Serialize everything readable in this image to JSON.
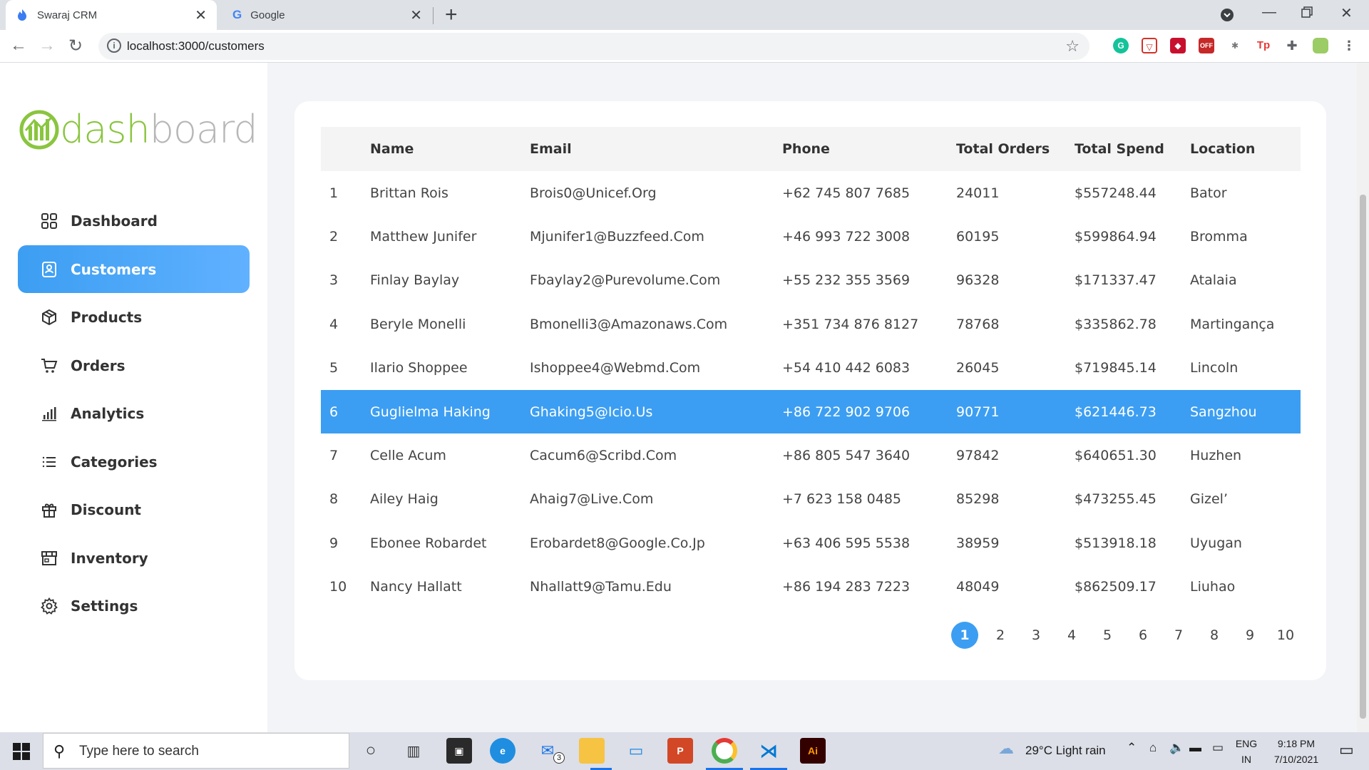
{
  "browser": {
    "tabs": [
      {
        "title": "Swaraj CRM",
        "active": true
      },
      {
        "title": "Google",
        "active": false
      }
    ],
    "url": "localhost:3000/customers"
  },
  "logo": {
    "text_green": "dash",
    "text_gray": "board"
  },
  "sidebar": {
    "items": [
      {
        "label": "Dashboard",
        "icon": "grid-icon",
        "active": false
      },
      {
        "label": "Customers",
        "icon": "contact-card-icon",
        "active": true
      },
      {
        "label": "Products",
        "icon": "package-icon",
        "active": false
      },
      {
        "label": "Orders",
        "icon": "cart-icon",
        "active": false
      },
      {
        "label": "Analytics",
        "icon": "bar-chart-icon",
        "active": false
      },
      {
        "label": "Categories",
        "icon": "list-icon",
        "active": false
      },
      {
        "label": "Discount",
        "icon": "gift-icon",
        "active": false
      },
      {
        "label": "Inventory",
        "icon": "storefront-icon",
        "active": false
      },
      {
        "label": "Settings",
        "icon": "gear-icon",
        "active": false
      }
    ]
  },
  "table": {
    "headers": [
      "",
      "Name",
      "Email",
      "Phone",
      "Total Orders",
      "Total Spend",
      "Location"
    ],
    "rows": [
      [
        "1",
        "Brittan Rois",
        "Brois0@Unicef.Org",
        "+62 745 807 7685",
        "24011",
        "$557248.44",
        "Bator"
      ],
      [
        "2",
        "Matthew Junifer",
        "Mjunifer1@Buzzfeed.Com",
        "+46 993 722 3008",
        "60195",
        "$599864.94",
        "Bromma"
      ],
      [
        "3",
        "Finlay Baylay",
        "Fbaylay2@Purevolume.Com",
        "+55 232 355 3569",
        "96328",
        "$171337.47",
        "Atalaia"
      ],
      [
        "4",
        "Beryle Monelli",
        "Bmonelli3@Amazonaws.Com",
        "+351 734 876 8127",
        "78768",
        "$335862.78",
        "Martingança"
      ],
      [
        "5",
        "Ilario Shoppee",
        "Ishoppee4@Webmd.Com",
        "+54 410 442 6083",
        "26045",
        "$719845.14",
        "Lincoln"
      ],
      [
        "6",
        "Guglielma Haking",
        "Ghaking5@Icio.Us",
        "+86 722 902 9706",
        "90771",
        "$621446.73",
        "Sangzhou"
      ],
      [
        "7",
        "Celle Acum",
        "Cacum6@Scribd.Com",
        "+86 805 547 3640",
        "97842",
        "$640651.30",
        "Huzhen"
      ],
      [
        "8",
        "Ailey Haig",
        "Ahaig7@Live.Com",
        "+7 623 158 0485",
        "85298",
        "$473255.45",
        "Gizel’"
      ],
      [
        "9",
        "Ebonee Robardet",
        "Erobardet8@Google.Co.Jp",
        "+63 406 595 5538",
        "38959",
        "$513918.18",
        "Uyugan"
      ],
      [
        "10",
        "Nancy Hallatt",
        "Nhallatt9@Tamu.Edu",
        "+86 194 283 7223",
        "48049",
        "$862509.17",
        "Liuhao"
      ]
    ],
    "highlighted_row": 6
  },
  "pagination": {
    "pages": [
      "1",
      "2",
      "3",
      "4",
      "5",
      "6",
      "7",
      "8",
      "9",
      "10"
    ],
    "current": 1
  },
  "taskbar": {
    "search_placeholder": "Type here to search",
    "mail_badge": "3",
    "weather": "29°C  Light rain",
    "lang_top": "ENG",
    "lang_bottom": "IN",
    "time": "9:18 PM",
    "date": "7/10/2021"
  },
  "colors": {
    "accent": "#3c9ef2",
    "logo_green": "#8ac53f"
  }
}
